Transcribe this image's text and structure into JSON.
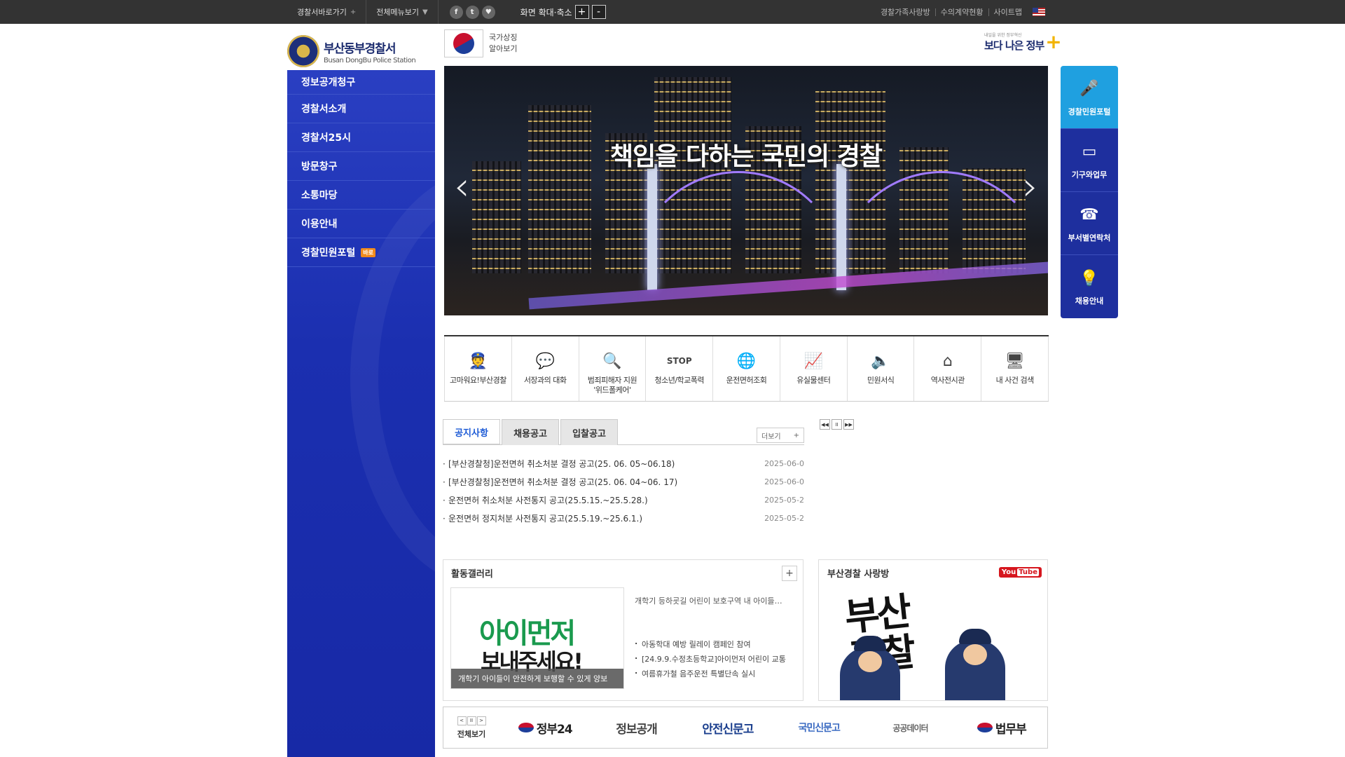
{
  "topbar": {
    "left_menus": [
      {
        "label": "경찰서바로가기",
        "mark": "+"
      },
      {
        "label": "전체메뉴보기",
        "mark": "▼"
      }
    ],
    "sns": [
      "f",
      "t",
      "♥"
    ],
    "zoom_label": "화면 확대·축소",
    "zoom_in": "+",
    "zoom_out": "-",
    "right_links": [
      "경찰가족사랑방",
      "수의계약현황",
      "사이트맵"
    ]
  },
  "logo": {
    "title": "부산동부경찰서",
    "subtitle": "Busan DongBu Police Station"
  },
  "sidenav": {
    "items": [
      "정보공개청구",
      "경찰서소개",
      "경찰서25시",
      "방문창구",
      "소통마당",
      "이용안내",
      "경찰민원포털"
    ],
    "badge": "바로"
  },
  "national_symbol": {
    "line1": "국가상징",
    "line2": "알아보기"
  },
  "gov_logo": {
    "small": "내일을 위한 정부혁신",
    "big": "보다 나은 정부"
  },
  "hero": {
    "slogan": "책임을 다하는 국민의 경찰",
    "prev": "‹",
    "next": "›"
  },
  "quick": [
    {
      "label": "경찰민원포털",
      "icon": "🎤"
    },
    {
      "label": "기구와업무",
      "icon": "▭"
    },
    {
      "label": "부서별연락처",
      "icon": "☎"
    },
    {
      "label": "채용안내",
      "icon": "💡"
    }
  ],
  "iconmenu": [
    {
      "label": "고마워요!부산경찰",
      "icon": "👮"
    },
    {
      "label": "서장과의 대화",
      "icon": "💬"
    },
    {
      "label": "범죄피해자 지원\n'위드폴케어'",
      "icon": "🔍"
    },
    {
      "label": "청소년/학교폭력",
      "icon": "STOP"
    },
    {
      "label": "운전면허조회",
      "icon": "🌐"
    },
    {
      "label": "유실물센터",
      "icon": "📈"
    },
    {
      "label": "민원서식",
      "icon": "🔈"
    },
    {
      "label": "역사전시관",
      "icon": "⌂"
    },
    {
      "label": "내 사건 검색",
      "icon": "🖥"
    }
  ],
  "notice": {
    "tabs": [
      "공지사항",
      "채용공고",
      "입찰공고"
    ],
    "more": "더보기",
    "items": [
      {
        "title": "[부산경찰청]운전면허 취소처분 결정 공고(25. 06. 05~06.18)",
        "date": "2025-06-0"
      },
      {
        "title": "[부산경찰청]운전면허 취소처분 결정 공고(25. 06. 04~06. 17)",
        "date": "2025-06-0"
      },
      {
        "title": "운전면허 취소처분 사전통지 공고(25.5.15.~25.5.28.)",
        "date": "2025-05-2"
      },
      {
        "title": "운전면허 정지처분 사전통지 공고(25.5.19.~25.6.1.)",
        "date": "2025-05-2"
      }
    ]
  },
  "rollctl": [
    "◀◀",
    "II",
    "▶▶"
  ],
  "gallery": {
    "title": "활동갤러리",
    "plus": "+",
    "thumb_line1": "아이먼저",
    "thumb_line2": "보내주세요!",
    "caption": "개학기 아이들이 안전하게 보행할 수 있게 양보",
    "lead": "개학기 등하굣길 어린이 보호구역 내 아이들…",
    "items": [
      "아동학대 예방 릴레이 캠페인 참여",
      "[24.9.9.수정초등학교]아이먼저 어린이 교통",
      "여름휴가철 음주운전 특별단속 실시"
    ]
  },
  "youtube": {
    "title": "부산경찰 사랑방",
    "logo_you": "You",
    "logo_tube": "Tube",
    "calligraphy": "부산\n경찰"
  },
  "banners": {
    "controls": [
      "<",
      "II",
      ">"
    ],
    "all": "전체보기",
    "items": [
      "정부24",
      "정보공개",
      "안전신문고",
      "국민신문고",
      "공공데이터",
      "법무부"
    ]
  }
}
